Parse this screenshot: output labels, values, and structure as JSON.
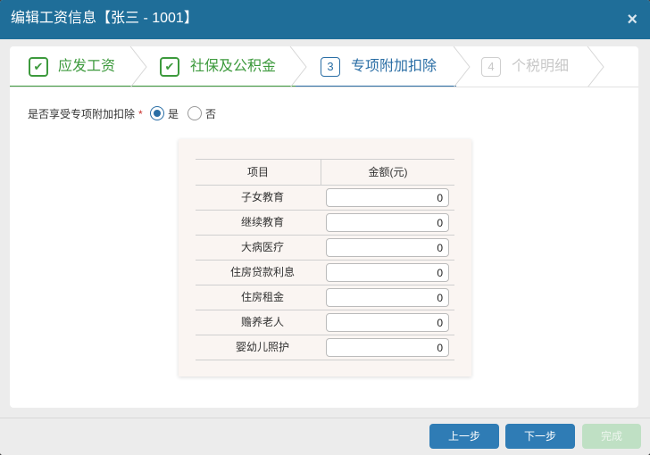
{
  "dialog": {
    "title": "编辑工资信息【张三 - 1001】",
    "close_symbol": "×"
  },
  "steps": [
    {
      "label": "应发工资",
      "status": "done",
      "marker": "✔"
    },
    {
      "label": "社保及公积金",
      "status": "done",
      "marker": "✔"
    },
    {
      "label": "专项附加扣除",
      "status": "active",
      "marker": "3"
    },
    {
      "label": "个税明细",
      "status": "disabled",
      "marker": "4"
    }
  ],
  "question": {
    "label": "是否享受专项附加扣除",
    "required_mark": "*",
    "option_yes": "是",
    "option_no": "否",
    "selected": "是"
  },
  "table": {
    "headers": [
      "项目",
      "金额(元)"
    ],
    "rows": [
      {
        "label": "子女教育",
        "value": "0"
      },
      {
        "label": "继续教育",
        "value": "0"
      },
      {
        "label": "大病医疗",
        "value": "0"
      },
      {
        "label": "住房贷款利息",
        "value": "0"
      },
      {
        "label": "住房租金",
        "value": "0"
      },
      {
        "label": "赡养老人",
        "value": "0"
      },
      {
        "label": "婴幼儿照护",
        "value": "0"
      }
    ]
  },
  "footer": {
    "prev_label": "上一步",
    "next_label": "下一步",
    "finish_label": "完成"
  },
  "colors": {
    "title_bar": "#1f6e99",
    "done": "#3d9a3d",
    "active": "#2a6ea5",
    "disabled": "#c8c8c8",
    "button": "#2f7cb5",
    "button_disabled": "#bfe0c4"
  }
}
